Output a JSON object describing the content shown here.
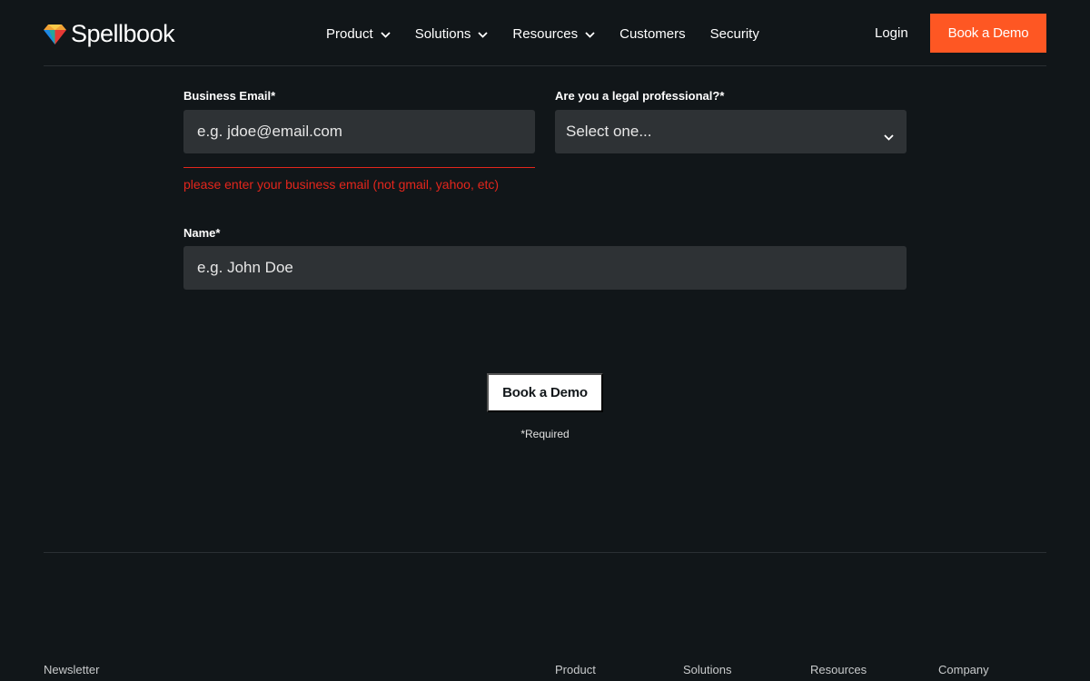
{
  "header": {
    "logo_text": "Spellbook",
    "nav": [
      {
        "label": "Product",
        "has_dropdown": true
      },
      {
        "label": "Solutions",
        "has_dropdown": true
      },
      {
        "label": "Resources",
        "has_dropdown": true
      },
      {
        "label": "Customers",
        "has_dropdown": false
      },
      {
        "label": "Security",
        "has_dropdown": false
      }
    ],
    "login_label": "Login",
    "cta_label": "Book a Demo"
  },
  "form": {
    "email": {
      "label": "Business Email*",
      "placeholder": "e.g. jdoe@email.com",
      "error": "please enter your business email (not gmail, yahoo, etc)"
    },
    "legal": {
      "label": "Are you a legal professional?*",
      "selected": "Select one..."
    },
    "name": {
      "label": "Name*",
      "placeholder": "e.g. John Doe"
    },
    "submit_label": "Book a Demo",
    "required_note": "*Required"
  },
  "footer": {
    "newsletter": "Newsletter",
    "columns": [
      "Product",
      "Solutions",
      "Resources",
      "Company"
    ]
  },
  "colors": {
    "background": "#111619",
    "accent": "#fe5723",
    "error": "#e3261c",
    "field_bg": "#2e3235"
  }
}
